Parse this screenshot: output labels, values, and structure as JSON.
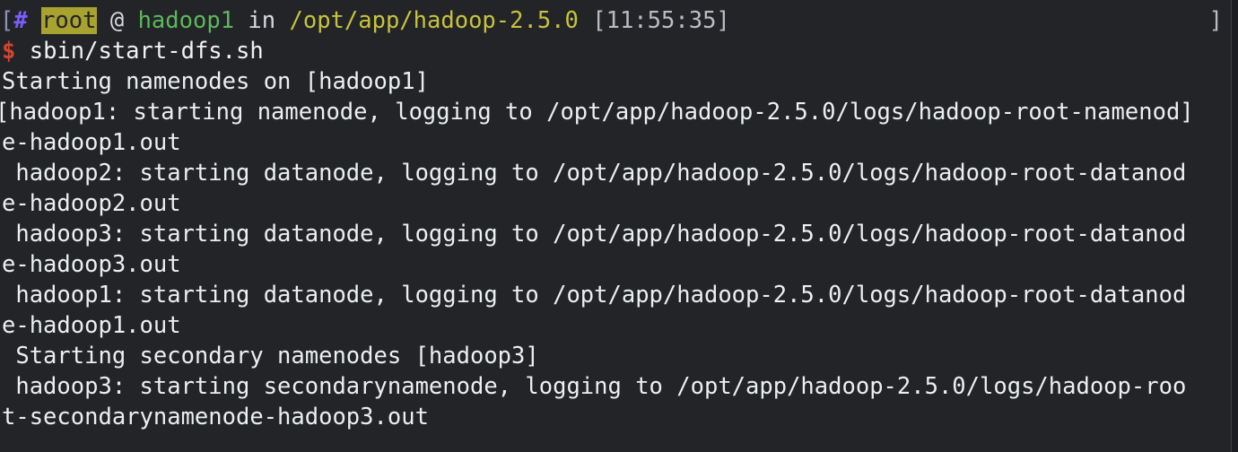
{
  "terminal": {
    "background_color": "#232428",
    "foreground_color": "#eceff1",
    "prompt": {
      "open_bracket": "[",
      "hash": "#",
      "user": "root",
      "at": "@",
      "host": "hadoop1",
      "in_word": "in",
      "path": "/opt/app/hadoop-2.5.0",
      "time": "[11:55:35]",
      "close_bracket": "]",
      "colors": {
        "user_bg": "#a8a22e",
        "user_fg": "#232428",
        "hash": "#7b5cff",
        "host": "#5bb85b",
        "path": "#c8c33c",
        "time": "#b9bcc1",
        "dollar": "#d4452e"
      }
    },
    "command": {
      "symbol": "$",
      "text": "sbin/start-dfs.sh"
    },
    "output_lines": [
      "Starting namenodes on [hadoop1]",
      "[hadoop1: starting namenode, logging to /opt/app/hadoop-2.5.0/logs/hadoop-root-namenod]",
      "e-hadoop1.out",
      " hadoop2: starting datanode, logging to /opt/app/hadoop-2.5.0/logs/hadoop-root-datanod",
      "e-hadoop2.out",
      " hadoop3: starting datanode, logging to /opt/app/hadoop-2.5.0/logs/hadoop-root-datanod",
      "e-hadoop3.out",
      " hadoop1: starting datanode, logging to /opt/app/hadoop-2.5.0/logs/hadoop-root-datanod",
      "e-hadoop1.out",
      " Starting secondary namenodes [hadoop3]",
      " hadoop3: starting secondarynamenode, logging to /opt/app/hadoop-2.5.0/logs/hadoop-roo",
      "t-secondarynamenode-hadoop3.out"
    ]
  }
}
